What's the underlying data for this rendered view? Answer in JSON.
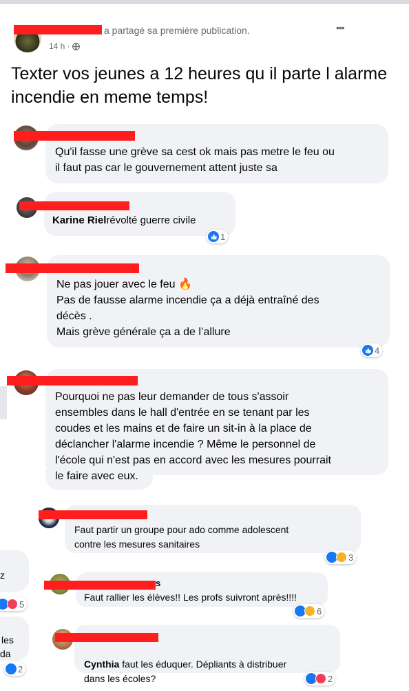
{
  "post": {
    "shared_text": "a partagé sa première publication.",
    "time": "14 h ·",
    "more_label": "•••",
    "body": "Texter vos jeunes a 12 heures qu il parte l alarme incendie en meme temps!"
  },
  "comments": [
    {
      "author": "",
      "text": "Qu'il fasse une grève sa cest ok mais pas metre le feu ou\nil faut pas car le gouvernement attent juste sa",
      "reactions": null
    },
    {
      "author": "Karine Riel",
      "text": "révolté guerre civile",
      "reactions": "1"
    },
    {
      "author": "",
      "text": "Ne pas jouer avec le feu 🔥\nPas de fausse alarme incendie ça a déjà entraîné des\ndécès .\nMais grève générale ça a de l’allure",
      "reactions": "4"
    },
    {
      "author": "",
      "text": "Pourquoi ne pas leur demander de tous s'assoir\nensembles dans le hall d'entrée en se tenant par les\ncoudes et les mains et de faire un sit-in à la place de\ndéclancher l'alarme incendie ? Même le personnel de\nl'école qui n'est pas en accord avec les mesures pourrait\nle faire avec eux.",
      "reactions": null
    }
  ],
  "replies": [
    {
      "author": "",
      "text": "Faut partir un groupe pour ado comme adolescent\ncontre les mesures sanitaires",
      "reactions": "3"
    },
    {
      "author": "",
      "text": "Faut rallier les élèves!! Les profs suivront après!!!!",
      "reactions": "6"
    },
    {
      "author": "Cynthia",
      "text": "faut les éduquer. Dépliants à distribuer\ndans les écoles?",
      "reactions": "2"
    }
  ],
  "side_fragments": {
    "frag1": "z",
    "frag1_count": "5",
    "frag2_line1": "les",
    "frag2_line2": "da",
    "frag2_count": "2"
  },
  "colors": {
    "like": "#1877f2",
    "love": "#f33e58",
    "redaction": "#ff1e1e",
    "bubble": "#f0f2f5"
  }
}
